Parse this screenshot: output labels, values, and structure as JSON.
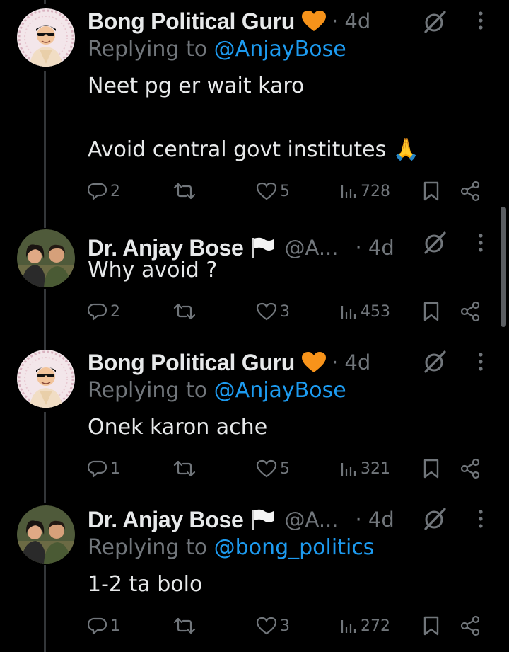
{
  "tweets": [
    {
      "name": "Bong Political Guru",
      "badge": "orange-heart",
      "handle": "",
      "time": "· 4d",
      "replying_prefix": "Replying to ",
      "replying_to": "@AnjayBose",
      "text_lines": [
        "Neet pg er wait karo",
        "",
        "Avoid central govt institutes 🙏"
      ],
      "replies": "2",
      "retweets": "",
      "likes": "5",
      "views": "728"
    },
    {
      "name": "Dr. Anjay Bose",
      "badge": "white-flag",
      "handle": "@A...",
      "time": "· 4d",
      "replying_prefix": "",
      "replying_to": "",
      "text_lines": [
        "Why avoid ?"
      ],
      "replies": "2",
      "retweets": "",
      "likes": "3",
      "views": "453"
    },
    {
      "name": "Bong Political Guru",
      "badge": "orange-heart",
      "handle": "",
      "time": "· 4d",
      "replying_prefix": "Replying to ",
      "replying_to": "@AnjayBose",
      "text_lines": [
        "Onek karon ache"
      ],
      "replies": "1",
      "retweets": "",
      "likes": "5",
      "views": "321"
    },
    {
      "name": "Dr. Anjay Bose",
      "badge": "white-flag",
      "handle": "@A...",
      "time": "· 4d",
      "replying_prefix": "Replying to ",
      "replying_to": "@bong_politics",
      "text_lines": [
        "1-2 ta bolo"
      ],
      "replies": "1",
      "retweets": "",
      "likes": "3",
      "views": "272"
    }
  ],
  "colors": {
    "background": "#000000",
    "text": "#e7e9ea",
    "muted": "#71767b",
    "link": "#1d9bf0",
    "heart_badge": "#f7931a"
  }
}
